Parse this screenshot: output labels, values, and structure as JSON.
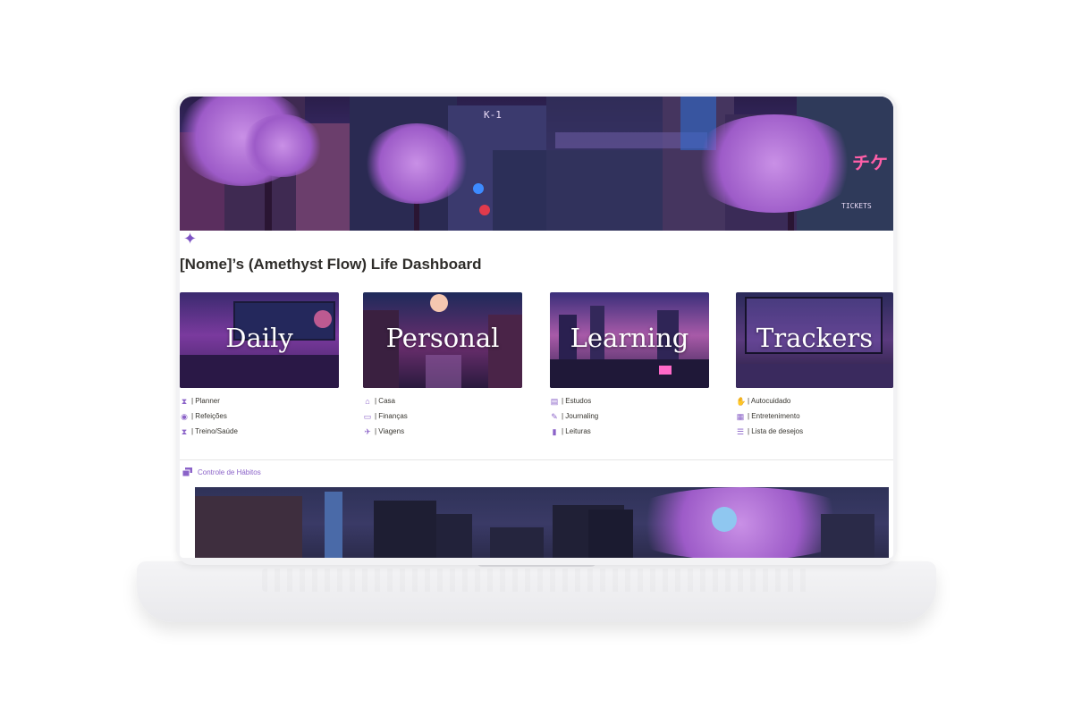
{
  "page": {
    "title": "[Nome]’s (Amethyst Flow) Life Dashboard",
    "page_icon": "sparkle-icon"
  },
  "cover": {
    "signs": [
      "K-1",
      "チケ",
      "TICKETS"
    ]
  },
  "cards": [
    {
      "label": "Daily",
      "links": [
        {
          "icon": "hourglass-icon",
          "text": "| Planner"
        },
        {
          "icon": "target-icon",
          "text": "| Refeições"
        },
        {
          "icon": "hourglass-icon",
          "text": "| Treino/Saúde"
        }
      ]
    },
    {
      "label": "Personal",
      "links": [
        {
          "icon": "home-icon",
          "text": "| Casa"
        },
        {
          "icon": "wallet-icon",
          "text": "| Finanças"
        },
        {
          "icon": "plane-icon",
          "text": "| Viagens"
        }
      ]
    },
    {
      "label": "Learning",
      "links": [
        {
          "icon": "book-icon",
          "text": "| Estudos"
        },
        {
          "icon": "pen-icon",
          "text": "| Journaling"
        },
        {
          "icon": "bookmark-icon",
          "text": "| Leituras"
        }
      ]
    },
    {
      "label": "Trackers",
      "links": [
        {
          "icon": "hand-icon",
          "text": "| Autocuidado"
        },
        {
          "icon": "film-icon",
          "text": "| Entretenimento"
        },
        {
          "icon": "list-icon",
          "text": "| Lista de desejos"
        }
      ]
    }
  ],
  "habits": {
    "label": "Controle de Hábitos",
    "icon": "database-icon"
  },
  "colors": {
    "accent": "#8b63c8",
    "text": "#37352f"
  }
}
